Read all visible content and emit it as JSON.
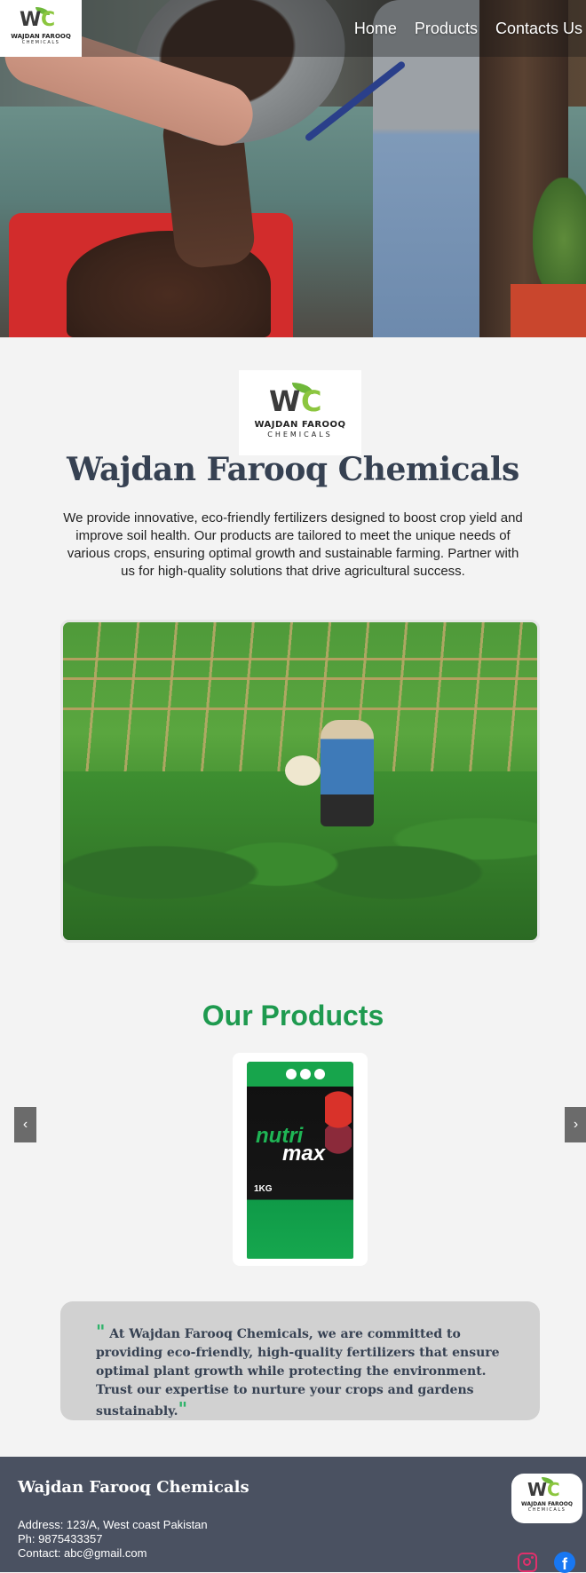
{
  "brand": {
    "logo_mark": "WFC",
    "logo_line1": "WAJDAN FAROOQ",
    "logo_line2": "CHEMICALS"
  },
  "nav": {
    "items": [
      {
        "label": "Home"
      },
      {
        "label": "Products"
      },
      {
        "label": "Contacts Us"
      }
    ]
  },
  "intro": {
    "title": "Wajdan Farooq Chemicals",
    "description": "We provide innovative, eco-friendly fertilizers designed to boost crop yield and improve soil health. Our products are tailored to meet the unique needs of various crops, ensuring optimal growth and sustainable farming. Partner with us for high-quality solutions that drive agricultural success."
  },
  "products": {
    "title": "Our Products",
    "prev_icon": "chevron-left-icon",
    "next_icon": "chevron-right-icon",
    "prev_glyph": "‹",
    "next_glyph": "›",
    "items": [
      {
        "brand_part1": "nutri",
        "brand_part2": "max",
        "weight": "1KG"
      }
    ]
  },
  "quote": {
    "open_mark": "\"",
    "close_mark": "\"",
    "text": "At Wajdan Farooq Chemicals, we are committed to providing eco-friendly, high-quality fertilizers that ensure optimal plant growth while protecting the environment. Trust our expertise to nurture your crops and gardens sustainably."
  },
  "footer": {
    "title": "Wajdan Farooq Chemicals",
    "address": "Address: 123/A, West coast Pakistan",
    "phone": "Ph: 9875433357",
    "contact": "Contact: abc@gmail.com",
    "social": [
      {
        "icon": "instagram-icon",
        "color": "#e1306c"
      },
      {
        "icon": "facebook-icon",
        "color": "#1877f2"
      }
    ]
  },
  "colors": {
    "accent_green": "#1e9a4f",
    "title_slate": "#364152",
    "footer_bg": "#4a5161",
    "quote_bg": "#d1d1d1"
  }
}
